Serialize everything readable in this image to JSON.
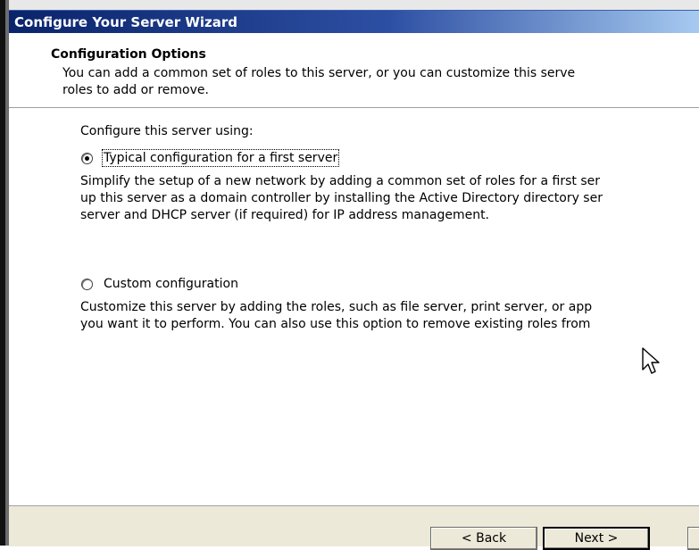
{
  "window": {
    "title": "Configure Your Server Wizard"
  },
  "header": {
    "title": "Configuration Options",
    "description_lines": [
      "You can add a common set of roles to this server, or you can customize this serve",
      "roles to add or remove."
    ]
  },
  "main": {
    "prompt": "Configure this server using:",
    "options": [
      {
        "label": "Typical configuration for a first server",
        "selected": true,
        "description_lines": [
          "Simplify the setup of a new network by adding a common set of roles for a first ser",
          "up this server as a domain controller by installing the Active Directory directory ser",
          "server and DHCP server (if required) for IP address management."
        ]
      },
      {
        "label": "Custom configuration",
        "selected": false,
        "description_lines": [
          "Customize this server by adding the roles, such as file server, print server, or app",
          "you want it to perform. You can also use this option to remove existing roles from"
        ]
      }
    ]
  },
  "footer": {
    "back_label": "< Back",
    "next_label": "Next >"
  },
  "colors": {
    "titlebar_start": "#0a246a",
    "titlebar_end": "#a6caf0",
    "button_face": "#ece9d8"
  }
}
